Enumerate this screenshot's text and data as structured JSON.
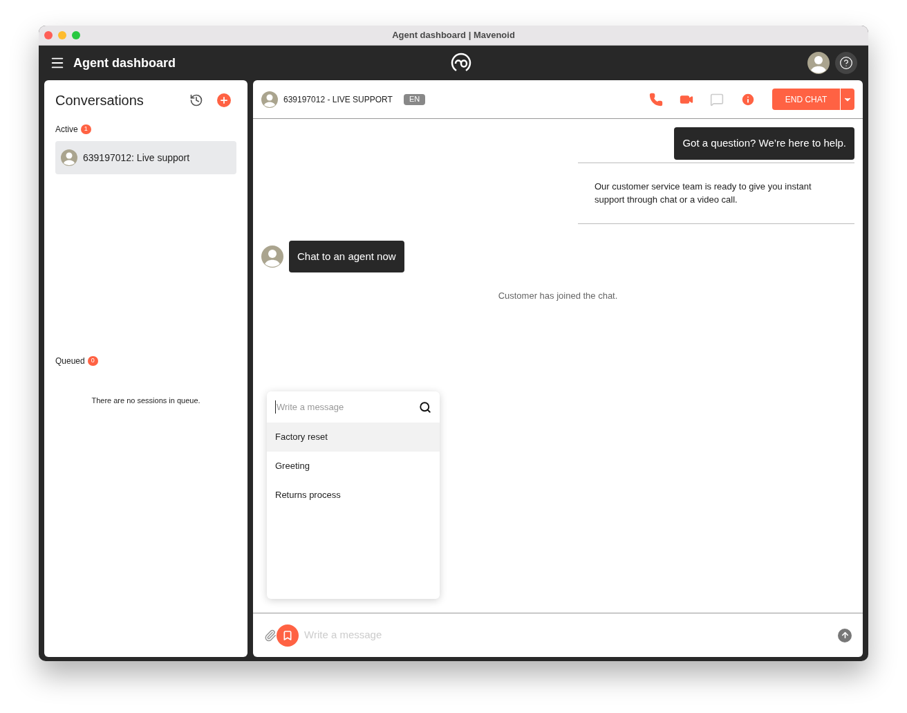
{
  "window": {
    "title": "Agent dashboard | Mavenoid"
  },
  "header": {
    "title": "Agent dashboard"
  },
  "sidebar": {
    "title": "Conversations",
    "sections": [
      {
        "label": "Active",
        "count": "1",
        "items": [
          {
            "label": "639197012: Live support",
            "selected": true
          }
        ]
      },
      {
        "label": "Queued",
        "count": "0",
        "empty_text": "There are no sessions in queue."
      }
    ]
  },
  "chat": {
    "title": "639197012 - LIVE SUPPORT",
    "language": "EN",
    "end_button": "END CHAT",
    "messages": [
      {
        "kind": "agent",
        "text": "Got a question? We’re here to help."
      },
      {
        "kind": "card",
        "text": "Our customer service team is ready to give you instant support through chat or a video call."
      },
      {
        "kind": "customer",
        "text": "Chat to an agent now"
      },
      {
        "kind": "system",
        "text": "Customer has joined the chat."
      }
    ],
    "canned": {
      "placeholder": "Write a message",
      "items": [
        {
          "label": "Factory reset",
          "selected": true
        },
        {
          "label": "Greeting",
          "selected": false
        },
        {
          "label": "Returns process",
          "selected": false
        }
      ]
    },
    "composer": {
      "placeholder": "Write a message"
    }
  }
}
